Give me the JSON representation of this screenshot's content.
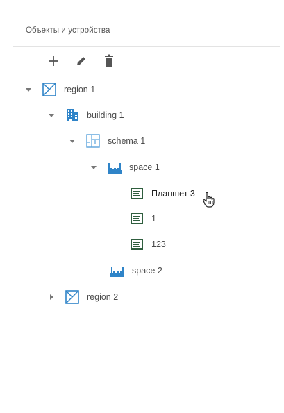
{
  "panel": {
    "title": "Объекты и устройства"
  },
  "toolbar": {
    "add_icon": "plus-icon",
    "edit_icon": "pencil-icon",
    "delete_icon": "trash-icon"
  },
  "tree": {
    "region1": {
      "label": "region 1",
      "icon": "region-icon",
      "expanded": true
    },
    "building1": {
      "label": "building 1",
      "icon": "building-icon",
      "expanded": true
    },
    "schema1": {
      "label": "schema 1",
      "icon": "schema-icon",
      "expanded": true
    },
    "space1": {
      "label": "space 1",
      "icon": "space-icon",
      "expanded": true
    },
    "device1": {
      "label": "Планшет 3",
      "icon": "device-icon"
    },
    "device2": {
      "label": "1",
      "icon": "device-icon"
    },
    "device3": {
      "label": "123",
      "icon": "device-icon"
    },
    "space2": {
      "label": "space 2",
      "icon": "space-icon"
    },
    "region2": {
      "label": "region 2",
      "icon": "region-icon",
      "expanded": false
    }
  },
  "colors": {
    "accent_blue": "#2f84c8",
    "device_green": "#2f5e3e",
    "toolbar_gray": "#555555",
    "caret_gray": "#777777"
  }
}
